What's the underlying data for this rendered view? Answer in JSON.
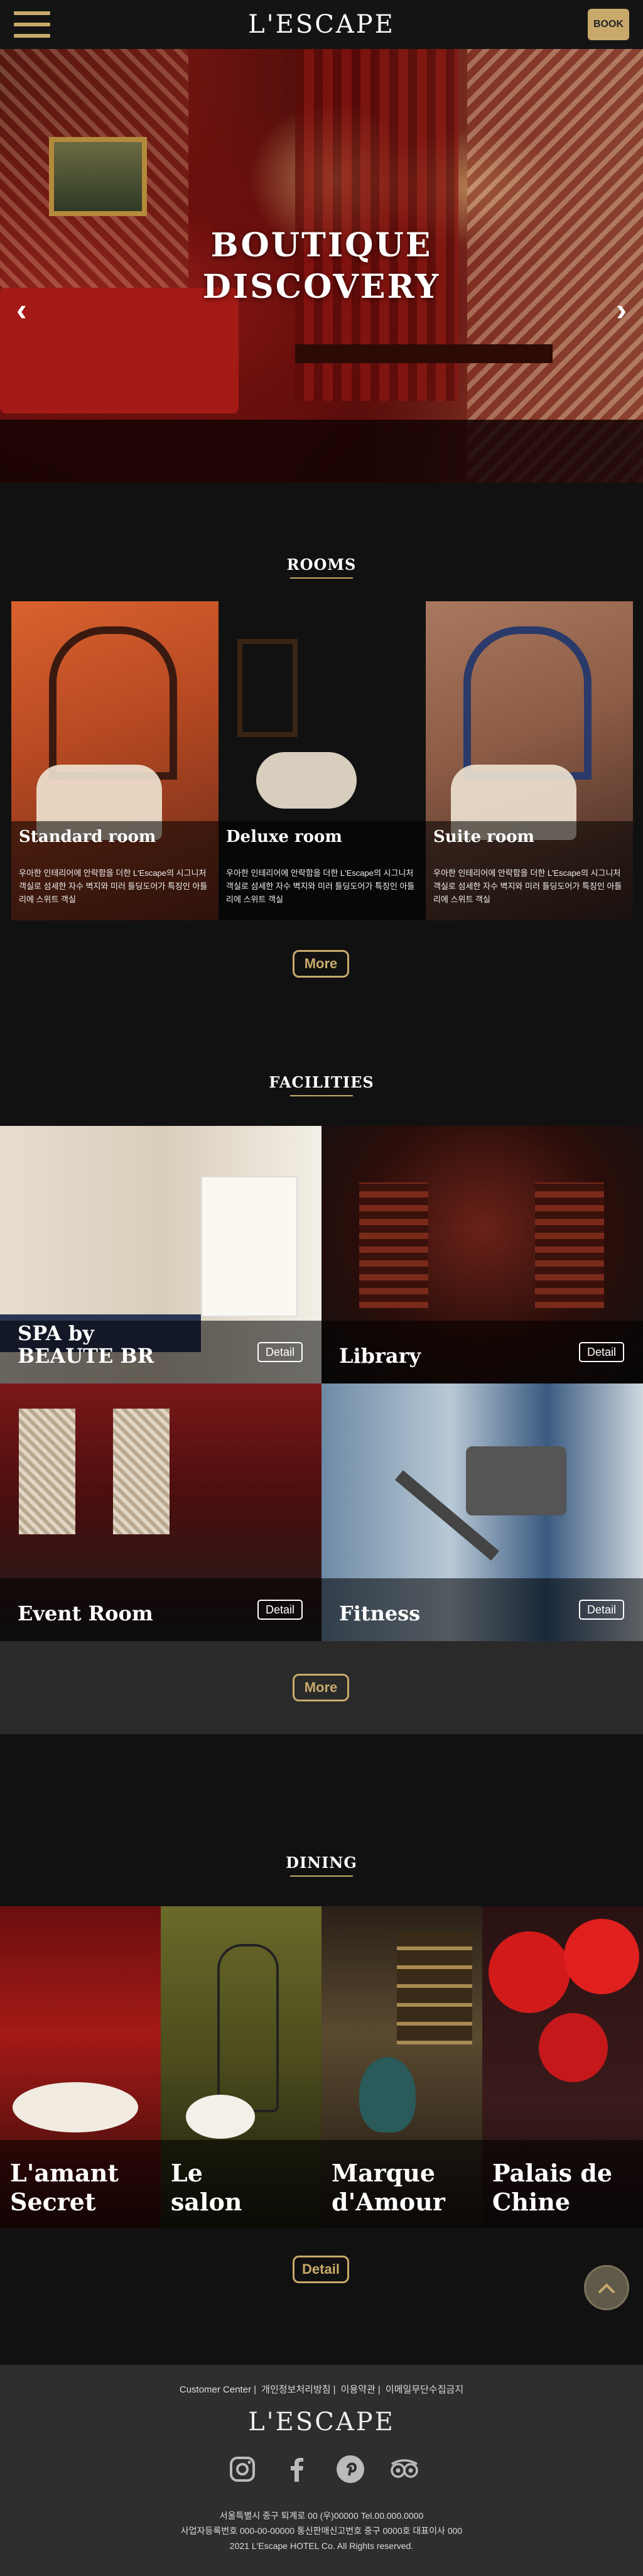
{
  "header": {
    "logo": "L'ESCAPE",
    "book_label": "BOOK",
    "menu_icon": "hamburger-menu-icon"
  },
  "hero": {
    "title_line1": "BOUTIQUE",
    "title_line2": "DISCOVERY",
    "prev_icon": "chevron-left-icon",
    "next_icon": "chevron-right-icon",
    "prev_glyph": "‹",
    "next_glyph": "›",
    "slide_count": 5,
    "active_slide": 1
  },
  "rooms": {
    "title": "ROOMS",
    "items": [
      {
        "name": "Standard room",
        "desc": "우아한 인테리어에 안락함을 더한 L'Escape의 시그니처 객실로 섬세한 자수 벽지와 미러 틀딩도어가 특징인 아틀리에 스위트 객실"
      },
      {
        "name": "Deluxe room",
        "desc": "우아한 인테리어에 안락함을 더한 L'Escape의 시그니처 객실로 섬세한 자수 벽지와 미러 틀딩도어가 특징인 아틀리에 스위트 객실"
      },
      {
        "name": "Suite room",
        "desc": "우아한 인테리어에 안락함을 더한 L'Escape의 시그니처 객실로 섬세한 자수 벽지와 미러 틀딩도어가 특징인 아틀리에 스위트 객실"
      }
    ],
    "more_label": "More"
  },
  "facilities": {
    "title": "FACILITIES",
    "items": [
      {
        "name_line1": "SPA by",
        "name_line2": "BEAUTE BR",
        "detail_label": "Detail"
      },
      {
        "name_line1": "Library",
        "name_line2": "",
        "detail_label": "Detail"
      },
      {
        "name_line1": "Event Room",
        "name_line2": "",
        "detail_label": "Detail"
      },
      {
        "name_line1": "Fitness",
        "name_line2": "",
        "detail_label": "Detail"
      }
    ],
    "more_label": "More"
  },
  "dining": {
    "title": "DINING",
    "items": [
      {
        "name_line1": "L'amant",
        "name_line2": "Secret"
      },
      {
        "name_line1": "Le",
        "name_line2": "salon"
      },
      {
        "name_line1": "Marque",
        "name_line2": "d'Amour"
      },
      {
        "name_line1": "Palais de",
        "name_line2": "Chine"
      }
    ],
    "detail_label": "Detail"
  },
  "scroll_top_icon": "chevron-up-icon",
  "footer": {
    "links": [
      "Customer Center",
      "개인정보처리방침",
      "이용약관",
      "이메일무단수집금지"
    ],
    "logo": "L'ESCAPE",
    "socials": [
      "instagram-icon",
      "facebook-icon",
      "pinterest-icon",
      "tripadvisor-icon"
    ],
    "address_line1": "서울특별시 중구 퇴계로 00 (우)00000 Tel.00.000.0000",
    "address_line2": "사업자등록번호 000-00-00000 통신판매신고번호 중구 0000호 대표이사 000",
    "copyright": "2021 L'Escape HOTEL Co. All Rights reserved."
  },
  "colors": {
    "accent": "#c9a96b",
    "background": "#111111",
    "footer": "#2e2e2e"
  }
}
